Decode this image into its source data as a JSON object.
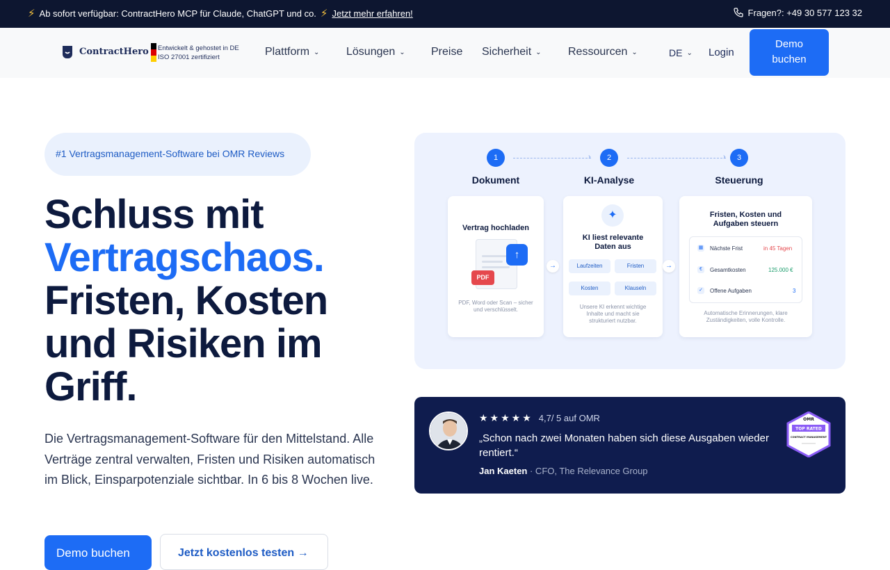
{
  "topbar": {
    "announcement": "Ab sofort verfügbar: ContractHero MCP für Claude, ChatGPT und co.",
    "link": "Jetzt mehr erfahren!",
    "contact": "Fragen?: +49 30 577 123 32"
  },
  "header": {
    "logo_text": "ContractHero",
    "trust_line1": "Entwickelt & gehostet in DE",
    "trust_line2": "ISO 27001 zertifiziert",
    "nav": [
      "Plattform",
      "Lösungen",
      "Preise",
      "Sicherheit",
      "Ressourcen"
    ],
    "language": "DE",
    "login": "Login",
    "demo_button": "Demo buchen"
  },
  "hero": {
    "badge": "#1 Vertragsmanagement-Software bei OMR Reviews",
    "headline_line1": "Schluss mit",
    "headline_highlight": "Vertragschaos.",
    "headline_rest": "Fristen, Kosten und Risiken im Griff.",
    "subtext": "Die Vertragsmanagement-Software für den Mittelstand. Alle Verträge zentral verwalten, Fristen und Risiken automatisch im Blick, Einsparpotenziale sichtbar. In 6 bis 8 Wochen live.",
    "cta_primary": "Demo buchen",
    "cta_secondary": "Jetzt kostenlos testen →"
  },
  "process": {
    "steps": [
      {
        "num": "1",
        "title": "Dokument"
      },
      {
        "num": "2",
        "title": "KI-Analyse"
      },
      {
        "num": "3",
        "title": "Steuerung"
      }
    ],
    "card1": {
      "title": "Vertrag hochladen",
      "pdf": "PDF",
      "note": "PDF, Word oder Scan – sicher und verschlüsselt."
    },
    "card2": {
      "title": "KI liest relevante Daten aus",
      "chips": [
        "Laufzeiten",
        "Fristen",
        "Kosten",
        "Klauseln"
      ],
      "note": "Unsere KI erkennt wichtige Inhalte und macht sie strukturiert nutzbar."
    },
    "card3": {
      "title": "Fristen, Kosten und Aufgaben steuern",
      "rows": [
        {
          "label": "Nächste Frist",
          "value": "in 45 Tagen",
          "color": "#e5484d"
        },
        {
          "label": "Gesamtkosten",
          "value": "125.000 €",
          "color": "#1a9c6b"
        },
        {
          "label": "Offene Aufgaben",
          "value": "3",
          "color": "#1d6cf5"
        }
      ],
      "note": "Automatische Erinnerungen, klare Zuständigkeiten, volle Kontrolle."
    }
  },
  "testimonial": {
    "stars": "★★★★★",
    "rating": "4,7/ 5 auf OMR",
    "quote": "„Schon nach zwei Monaten haben sich diese Ausgaben wieder rentiert.“",
    "author": "Jan Kaeten",
    "role": " · CFO, The Relevance Group",
    "badge_top": "OMR",
    "badge_label": "TOP RATED",
    "badge_sub": "CONTRACT MANAGEMENT"
  }
}
